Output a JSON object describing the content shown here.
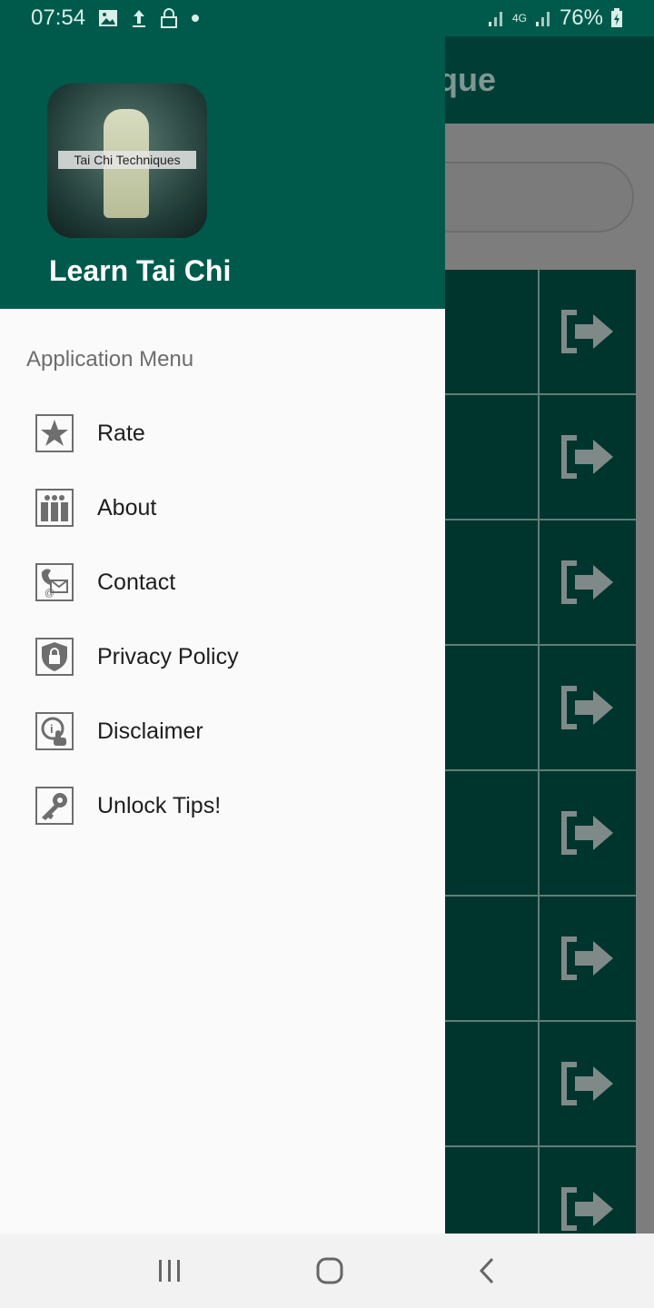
{
  "status_bar": {
    "time": "07:54",
    "network": "4G",
    "battery": "76%",
    "icons": [
      "image-icon",
      "upload-icon",
      "lock-icon",
      "dot-icon",
      "signal-icon",
      "battery-charging-icon"
    ]
  },
  "background_screen": {
    "title_fragment": "que",
    "row_count": 8,
    "row_icon": "exit-arrow-icon"
  },
  "drawer": {
    "logo_caption": "Tai Chi Techniques",
    "app_name": "Learn Tai Chi",
    "section_title": "Application Menu",
    "items": [
      {
        "label": "Rate",
        "icon": "star-icon"
      },
      {
        "label": "About",
        "icon": "people-icon"
      },
      {
        "label": "Contact",
        "icon": "phone-mail-icon"
      },
      {
        "label": "Privacy Policy",
        "icon": "shield-lock-icon"
      },
      {
        "label": "Disclaimer",
        "icon": "info-touch-icon"
      },
      {
        "label": "Unlock Tips!",
        "icon": "key-icon"
      }
    ]
  },
  "colors": {
    "primary": "#005a4c",
    "drawer_bg": "#fafafa",
    "icon_grey": "#6e6e6e"
  },
  "navbar": {
    "buttons": [
      "recents-button",
      "home-button",
      "back-button"
    ]
  }
}
